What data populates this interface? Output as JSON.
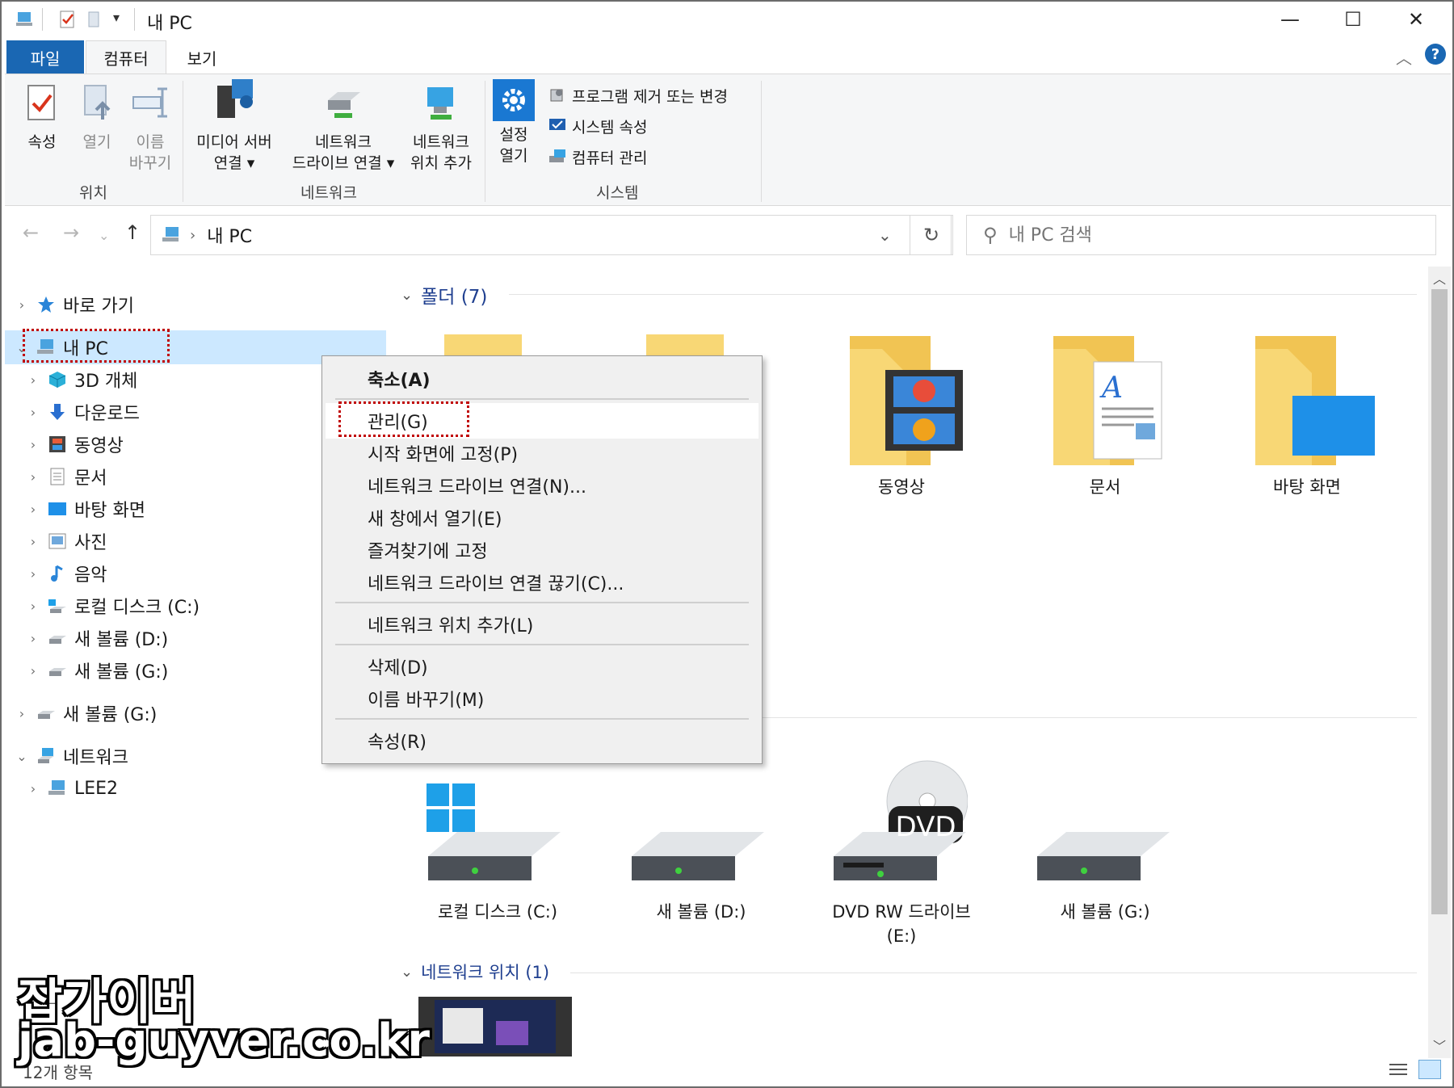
{
  "window": {
    "title": "내 PC",
    "min": "—",
    "max": "☐",
    "close": "✕"
  },
  "tabs": {
    "file": "파일",
    "computer": "컴퓨터",
    "view": "보기"
  },
  "ribbon": {
    "location": {
      "label": "위치",
      "properties": "속성",
      "open": "열기",
      "rename_l1": "이름",
      "rename_l2": "바꾸기"
    },
    "network": {
      "label": "네트워크",
      "media_l1": "미디어 서버",
      "media_l2": "연결 ▾",
      "map_l1": "네트워크",
      "map_l2": "드라이브 연결 ▾",
      "addloc_l1": "네트워크",
      "addloc_l2": "위치 추가"
    },
    "system": {
      "label": "시스템",
      "settings_l1": "설정",
      "settings_l2": "열기",
      "uninstall": "프로그램 제거 또는 변경",
      "sysprops": "시스템 속성",
      "manage": "컴퓨터 관리"
    }
  },
  "address": {
    "path": "내 PC",
    "search_placeholder": "내 PC 검색"
  },
  "nav": {
    "quick": "바로 가기",
    "thispc": "내 PC",
    "objects3d": "3D 개체",
    "downloads": "다운로드",
    "videos": "동영상",
    "documents": "문서",
    "desktop": "바탕 화면",
    "pictures": "사진",
    "music": "음악",
    "local_c": "로컬 디스크 (C:)",
    "vol_d": "새 볼륨 (D:)",
    "vol_g": "새 볼륨 (G:)",
    "vol_g2": "새 볼륨 (G:)",
    "network": "네트워크",
    "lee2": "LEE2"
  },
  "content": {
    "folders_header": "폴더 (7)",
    "folders": [
      "동영상",
      "문서",
      "바탕 화면"
    ],
    "drives": [
      "로컬 디스크 (C:)",
      "새 볼륨 (D:)",
      "DVD RW 드라이브",
      "새 볼륨 (G:)"
    ],
    "dvd_line2": "(E:)",
    "dvd_badge": "DVD",
    "netloc_header": "네트워크 위치 (1)"
  },
  "context_menu": {
    "collapse": "축소(A)",
    "manage": "관리(G)",
    "pin_start": "시작 화면에 고정(P)",
    "map_drive": "네트워크 드라이브 연결(N)...",
    "open_new": "새 창에서 열기(E)",
    "pin_quick": "즐겨찾기에 고정",
    "disconnect": "네트워크 드라이브 연결 끊기(C)...",
    "add_netloc": "네트워크 위치 추가(L)",
    "delete": "삭제(D)",
    "rename": "이름 바꾸기(M)",
    "properties": "속성(R)"
  },
  "status": {
    "count": "12개 항목"
  },
  "watermark": {
    "line1": "잡가이버",
    "line2": "jab-guyver.co.kr"
  },
  "colors": {
    "accent": "#1a67b3",
    "selection": "#cce8ff",
    "highlight_box": "#c00000",
    "folder": "#f8d775"
  }
}
